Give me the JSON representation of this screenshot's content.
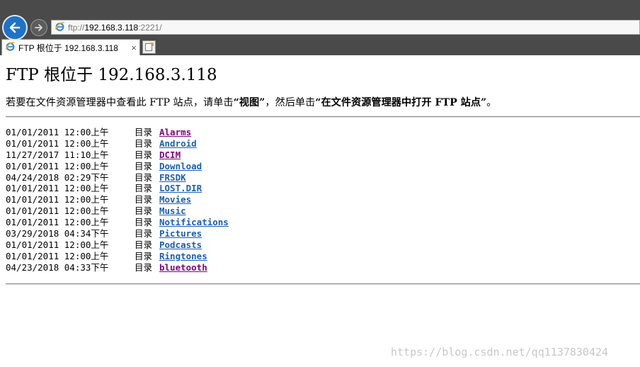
{
  "browser": {
    "address": {
      "scheme": "ftp://",
      "host": "192.168.3.118",
      "port_path": ":2221/"
    },
    "tab": {
      "title": "FTP 根位于 192.168.3.118",
      "close_glyph": "×"
    },
    "icons": {
      "back": "back-arrow-icon",
      "forward": "forward-arrow-icon",
      "page": "ie-page-icon",
      "new_tab": "new-tab-icon"
    },
    "colors": {
      "chrome": "#4a4a4a",
      "back_button": "#1e73c8",
      "link": "#1a5fb4",
      "visited_link": "#800080"
    }
  },
  "page": {
    "heading": "FTP 根位于 192.168.3.118",
    "instruction": {
      "before": "若要在文件资源管理器中查看此 FTP 站点，请单击",
      "view": "“视图”",
      "middle": "，然后单击",
      "open": "“在文件资源管理器中打开 FTP 站点”",
      "after": "。"
    },
    "listing": [
      {
        "date": "01/01/2011 12:00上午",
        "kind": "目录",
        "name": "Alarms",
        "visited": true
      },
      {
        "date": "01/01/2011 12:00上午",
        "kind": "目录",
        "name": "Android",
        "visited": false
      },
      {
        "date": "11/27/2017 11:10上午",
        "kind": "目录",
        "name": "DCIM",
        "visited": true
      },
      {
        "date": "01/01/2011 12:00上午",
        "kind": "目录",
        "name": "Download",
        "visited": false
      },
      {
        "date": "04/24/2018 02:29下午",
        "kind": "目录",
        "name": "FRSDK",
        "visited": false
      },
      {
        "date": "01/01/2011 12:00上午",
        "kind": "目录",
        "name": "LOST.DIR",
        "visited": false
      },
      {
        "date": "01/01/2011 12:00上午",
        "kind": "目录",
        "name": "Movies",
        "visited": false
      },
      {
        "date": "01/01/2011 12:00上午",
        "kind": "目录",
        "name": "Music",
        "visited": false
      },
      {
        "date": "01/01/2011 12:00上午",
        "kind": "目录",
        "name": "Notifications",
        "visited": false
      },
      {
        "date": "03/29/2018 04:34下午",
        "kind": "目录",
        "name": "Pictures",
        "visited": false
      },
      {
        "date": "01/01/2011 12:00上午",
        "kind": "目录",
        "name": "Podcasts",
        "visited": false
      },
      {
        "date": "01/01/2011 12:00上午",
        "kind": "目录",
        "name": "Ringtones",
        "visited": false
      },
      {
        "date": "04/23/2018 04:33下午",
        "kind": "目录",
        "name": "bluetooth",
        "visited": true
      }
    ]
  },
  "watermark": "https://blog.csdn.net/qq1137830424"
}
